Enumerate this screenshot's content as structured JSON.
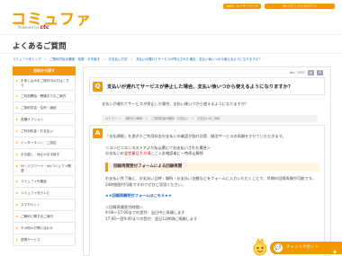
{
  "header": {
    "logo": "コミュファ",
    "logo_sub_prefix": "Powered by",
    "logo_sub_brand": "ctc",
    "btn_account": "Web・ユーザーページ",
    "btn_mypage": "Myコミュファ ログイン"
  },
  "page_title": "よくあるご質問",
  "breadcrumb": [
    "コミュファ光トップ",
    "ご契約内容の確認・変更・お手続き",
    "お支払い方法",
    "支払いが遅れてサービスが停止された場合、支払い後いつから使えるようになりますか？"
  ],
  "sidebar": {
    "heading": "目的から探す",
    "items": [
      "お申し込みをご検討中の方はこちら",
      "ご利用開始・開通までのご案内",
      "ご契約内容・住所・継続",
      "各種オプション",
      "ご利用料金・お支払い",
      "インターネット・ご設定",
      "お引越し・休止のお手続き",
      "ID・パスワード・Myコミュファ関連",
      "コミュファ光電話",
      "コミュファ光テレビ",
      "スマホセット",
      "ご解約に関するご案内",
      "その他のお問い合わせ",
      "提携サービス"
    ]
  },
  "question": {
    "meta_no": "No：1937",
    "badge": "Q",
    "title": "支払いが遅れてサービスが停止した場合、支払い後いつから使えるようになりますか？",
    "body": "支払いが遅れてサービスが停止した場合、支払い後いつから使えるようになりますか？",
    "tags": "カテゴリー：　契約から解約　＞　ご利用料金の確認・お支払い　＞　お支払いのご利用"
  },
  "answer": {
    "badge": "A",
    "p1": "「支払期限」を過ぎたご利用料金の支払いの確認が取れ次第、順次サービスの再開をさせていただきます。",
    "sub_title": "＜コンビニエンスストアより払込票にてお支払いされた場合＞",
    "p2_prefix": "お支払いの",
    "p2_red": "翌営業日夕方頃",
    "p2_suffix": "にご入金確認後に一時停止解除",
    "form_title": "回線再開受付フォームによる回線再開",
    "p3": "お支払い完了後に、お支払い日時・場所・お支払い金額などをフォームに入力いただくことで、早期の回線再開が可能です。",
    "p4": "24時間受付可能ですのでぜひご活用ください。",
    "link": "★★回線再開受付フォームはこちら★★",
    "hours_title": "＜回線再開受付時間＞",
    "hours1": "9:00～17:00までの受付：当日中に再開します",
    "hours2": "17:00～翌9:00までの受付：翌日11時頃に再開します"
  },
  "chat": {
    "label": "チャットサポート"
  },
  "colors": {
    "brand": "#f39800",
    "accent_red": "#e60012",
    "link": "#1a5fb4"
  }
}
